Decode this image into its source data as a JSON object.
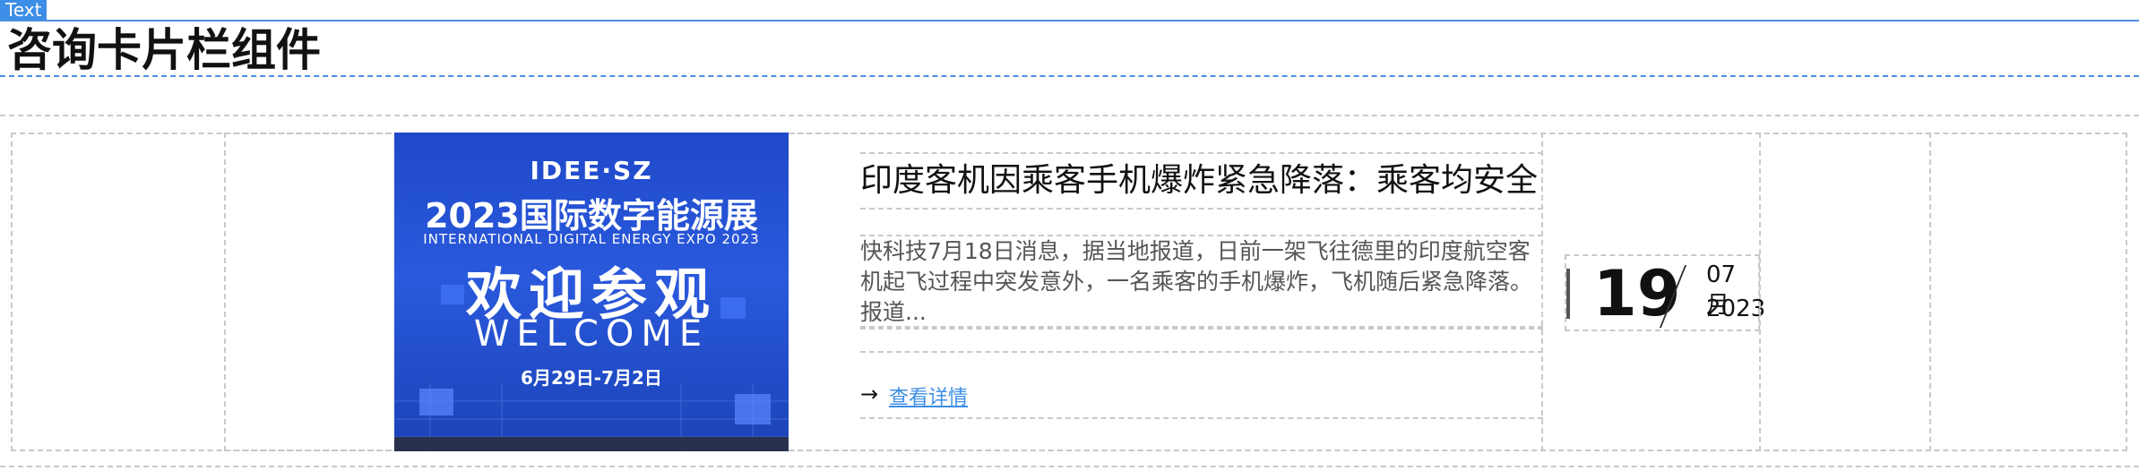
{
  "tag": {
    "label": "Text"
  },
  "page": {
    "title": "咨询卡片栏组件"
  },
  "card": {
    "image": {
      "logo_text": "IDEE·SZ",
      "title": "2023国际数字能源展",
      "subtitle": "INTERNATIONAL DIGITAL ENERGY EXPO 2023",
      "welcome_cn": "欢迎参观",
      "welcome_en": "WELCOME",
      "date_range": "6月29日-7月2日"
    },
    "headline": "印度客机因乘客手机爆炸紧急降落：乘客均安全",
    "summary": "快科技7月18日消息，据当地报道，日前一架飞往德里的印度航空客机起飞过程中突发意外，一名乘客的手机爆炸，飞机随后紧急降落。报道...",
    "link": {
      "arrow": "→",
      "label": "查看详情"
    },
    "date": {
      "day": "19",
      "month": "07月",
      "year": "2023"
    }
  },
  "colors": {
    "accent": "#3d8ee6",
    "border": "#c9c9c9",
    "poster_blue": "#1f49c9"
  },
  "icons": {
    "arrow": "arrow-right-icon"
  }
}
